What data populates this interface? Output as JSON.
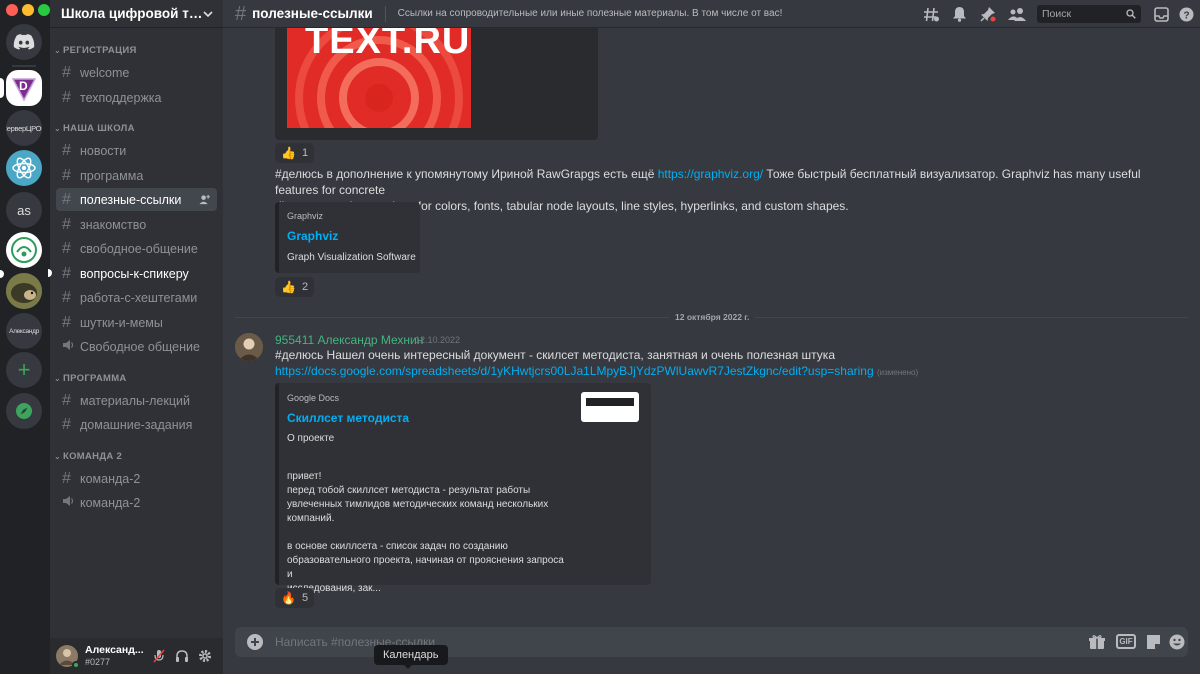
{
  "rail": {
    "servers": [
      {
        "label": "D"
      },
      {
        "label": "СерверЦРОИ"
      },
      {
        "label": ""
      },
      {
        "label": "as"
      },
      {
        "label": ""
      },
      {
        "label": ""
      },
      {
        "label": "Александр"
      }
    ]
  },
  "sidebar": {
    "guild_name": "Школа цифровой трансформации",
    "categories": [
      "РЕГИСТРАЦИЯ",
      "НАША ШКОЛА",
      "ПРОГРАММА",
      "КОМАНДА 2"
    ],
    "channels": [
      "welcome",
      "техподдержка",
      "новости",
      "программа",
      "полезные-ссылки",
      "знакомство",
      "свободное-общение",
      "вопросы-к-спикеру",
      "работа-с-хештегами",
      "шутки-и-мемы",
      "Свободное общение",
      "материалы-лекций",
      "домашние-задания",
      "команда-2",
      "команда-2"
    ],
    "active_channel": "полезные-ссылки"
  },
  "user": {
    "name": "Александ...",
    "tag": "#0277"
  },
  "topbar": {
    "channel": "полезные-ссылки",
    "topic": "Ссылки на сопроводительные или иные полезные материалы. В том числе от вас!",
    "search_placeholder": "Поиск"
  },
  "messages": {
    "image_text": "TEXT.RU",
    "reaction1_count": "1",
    "msg1_prefix": "#делюсь в дополнение к упомянутому Ириной RawGrapgs есть ещё ",
    "msg1_link": "https://graphviz.org/",
    "msg1_suffix": " Тоже быстрый бесплатный визуализатор. Graphviz has many useful features for concrete",
    "msg1_line2": "diagrams, such as options for colors, fonts, tabular node layouts, line styles, hyperlinks, and custom shapes.",
    "embed1": {
      "provider": "Graphviz",
      "title": "Graphviz",
      "description": "Graph Visualization Software"
    },
    "reaction2_count": "2",
    "date_divider": "12 октября 2022 г.",
    "author": "955411 Александр Мехнин",
    "timestamp": "12.10.2022",
    "msg2_text": "#делюсь Нашел очень интересный документ - скилсет методиста, занятная и очень полезная штука",
    "msg2_link": "https://docs.google.com/spreadsheets/d/1yKHwtjcrs00LJa1LMpyBJjYdzPWlUawvR7JestZkgnc/edit?usp=sharing",
    "edited": "(изменено)",
    "embed2": {
      "provider": "Google Docs",
      "title": "Скиллсет методиста",
      "subtitle": "О проекте",
      "description": "привет!\nперед тобой скиллсет методиста - результат работы\nувлеченных тимлидов методических команд нескольких\nкомпаний.\n\nв основе скиллсета - список задач по созданию\nобразовательного проекта, начиная от прояснения запроса и\nисследования, зак..."
    },
    "reaction3_count": "5"
  },
  "composer": {
    "placeholder": "Написать #полезные-ссылки",
    "gif_label": "GIF"
  },
  "tooltip": "Календарь",
  "colors": {
    "accent": "#5865f2",
    "link": "#00aff4",
    "author": "#43b581",
    "online": "#3ba55d"
  }
}
